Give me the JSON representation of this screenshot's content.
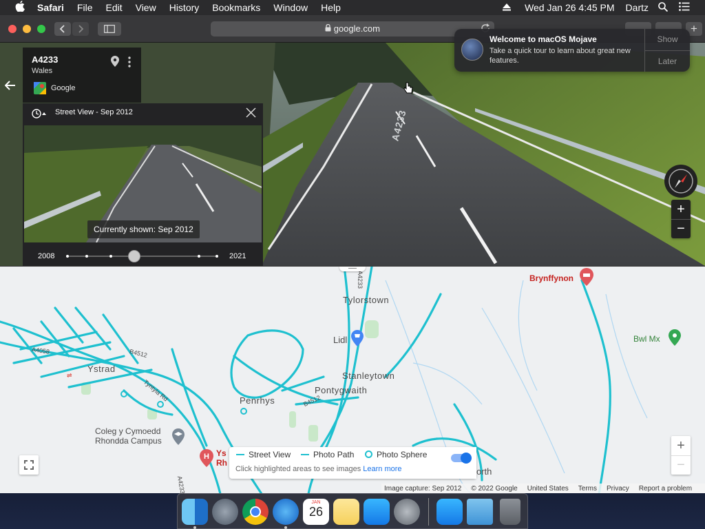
{
  "menubar": {
    "apple": "",
    "app_name": "Safari",
    "items": [
      "File",
      "Edit",
      "View",
      "History",
      "Bookmarks",
      "Window",
      "Help"
    ],
    "clock": "Wed Jan 26  4:45 PM",
    "user": "Dartz"
  },
  "toolbar": {
    "url": "google.com",
    "lock_icon": "lock-icon"
  },
  "notification": {
    "title": "Welcome to macOS Mojave",
    "body": "Take a quick tour to learn about great new features.",
    "show_label": "Show",
    "later_label": "Later"
  },
  "info_card": {
    "road": "A4233",
    "region": "Wales",
    "source": "Google"
  },
  "time_travel": {
    "header": "Street View - Sep 2012",
    "current": "Currently shown: Sep 2012",
    "start_year": "2008",
    "end_year": "2021"
  },
  "road_marking": "A4233",
  "street_view_controls": {
    "zoom_in": "+",
    "zoom_out": "−"
  },
  "map": {
    "labels": {
      "tylorstown": "Tylorstown",
      "brynffynon": "Brynffynon",
      "lidl": "Lidl",
      "bwl_mx": "Bwl Mx",
      "ystrad": "Ystrad",
      "a4058": "A4058",
      "b4512": "B4512",
      "stanleytown": "Stanleytown",
      "pontygwaith": "Pontygwaith",
      "penrhys": "Penrhys",
      "b4512b": "B4512",
      "tyntyla": "Tyntyla Rd",
      "coleg1": "Coleg y Cymoedd",
      "coleg2": "Rhondda Campus",
      "ys": "Ys",
      "rh": "Rh",
      "orth": "orth",
      "a4233": "A4233",
      "a4233b": "A4233"
    },
    "legend": {
      "street_view": "Street View",
      "photo_path": "Photo Path",
      "photo_sphere": "Photo Sphere",
      "hint": "Click highlighted areas to see images",
      "learn_more": "Learn more"
    },
    "zoom_in": "+",
    "zoom_out": "−",
    "footer": {
      "capture": "Image capture: Sep 2012",
      "copyright": "© 2022 Google",
      "country": "United States",
      "terms": "Terms",
      "privacy": "Privacy",
      "report": "Report a problem"
    }
  },
  "dock": {
    "calendar_month": "JAN",
    "calendar_day": "26"
  },
  "colors": {
    "streetview_blue": "#1ec0cf",
    "toggle_blue": "#1a73e8",
    "pin_red": "#e0565b",
    "pin_green": "#34a853"
  }
}
